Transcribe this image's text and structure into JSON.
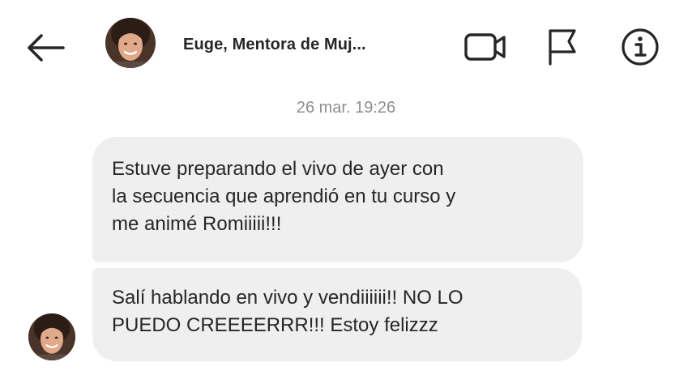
{
  "header": {
    "back_icon": "arrow-left-icon",
    "contact_name": "Euge, Mentora de Muj...",
    "video_icon": "video-camera-icon",
    "flag_icon": "flag-icon",
    "info_icon": "info-icon"
  },
  "conversation": {
    "timestamp": "26 mar. 19:26",
    "messages": [
      {
        "lines": [
          "Estuve preparando el vivo de ayer con",
          "la secuencia que aprendió en tu curso y",
          "me animé Romiiiii!!!"
        ]
      },
      {
        "lines": [
          "Salí hablando en vivo y vendiiiiii!! NO LO",
          "PUEDO CREEEERRR!!! Estoy felizzz"
        ]
      }
    ]
  },
  "colors": {
    "bubble_bg": "#efefef",
    "text": "#262626",
    "timestamp": "#8e8e8e"
  }
}
